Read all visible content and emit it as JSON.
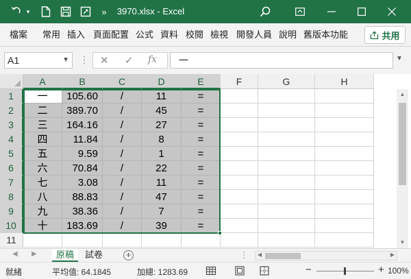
{
  "window": {
    "title": "3970.xlsx  -  Excel",
    "undo_icon": "undo-icon",
    "redo_icon": "redo-icon"
  },
  "ribbon": {
    "tabs": [
      "檔案",
      "常用",
      "插入",
      "頁面配置",
      "公式",
      "資料",
      "校閱",
      "檢視",
      "開發人員",
      "說明",
      "舊版本功能"
    ],
    "share_label": "共用"
  },
  "formula_bar": {
    "name_box": "A1",
    "formula": "一"
  },
  "grid": {
    "columns": [
      "A",
      "B",
      "C",
      "D",
      "E",
      "F",
      "G",
      "H"
    ],
    "rows": [
      "1",
      "2",
      "3",
      "4",
      "5",
      "6",
      "7",
      "8",
      "9",
      "10",
      "11"
    ],
    "cells": [
      [
        "一",
        "105.60",
        "/",
        "11",
        "="
      ],
      [
        "二",
        "389.70",
        "/",
        "45",
        "="
      ],
      [
        "三",
        "164.16",
        "/",
        "27",
        "="
      ],
      [
        "四",
        "11.84",
        "/",
        "8",
        "="
      ],
      [
        "五",
        "9.59",
        "/",
        "1",
        "="
      ],
      [
        "六",
        "70.84",
        "/",
        "22",
        "="
      ],
      [
        "七",
        "3.08",
        "/",
        "11",
        "="
      ],
      [
        "八",
        "88.83",
        "/",
        "47",
        "="
      ],
      [
        "九",
        "38.36",
        "/",
        "7",
        "="
      ],
      [
        "十",
        "183.69",
        "/",
        "39",
        "="
      ]
    ],
    "selection": "A1:E10"
  },
  "sheets": {
    "tabs": [
      "原稿",
      "試卷"
    ],
    "active": "原稿"
  },
  "status": {
    "mode": "就緒",
    "average": "平均值: 64.1845",
    "sum": "加總: 1283.69",
    "zoom": "100%"
  },
  "colors": {
    "accent": "#217346",
    "selection_fill": "#c6c6c6"
  }
}
